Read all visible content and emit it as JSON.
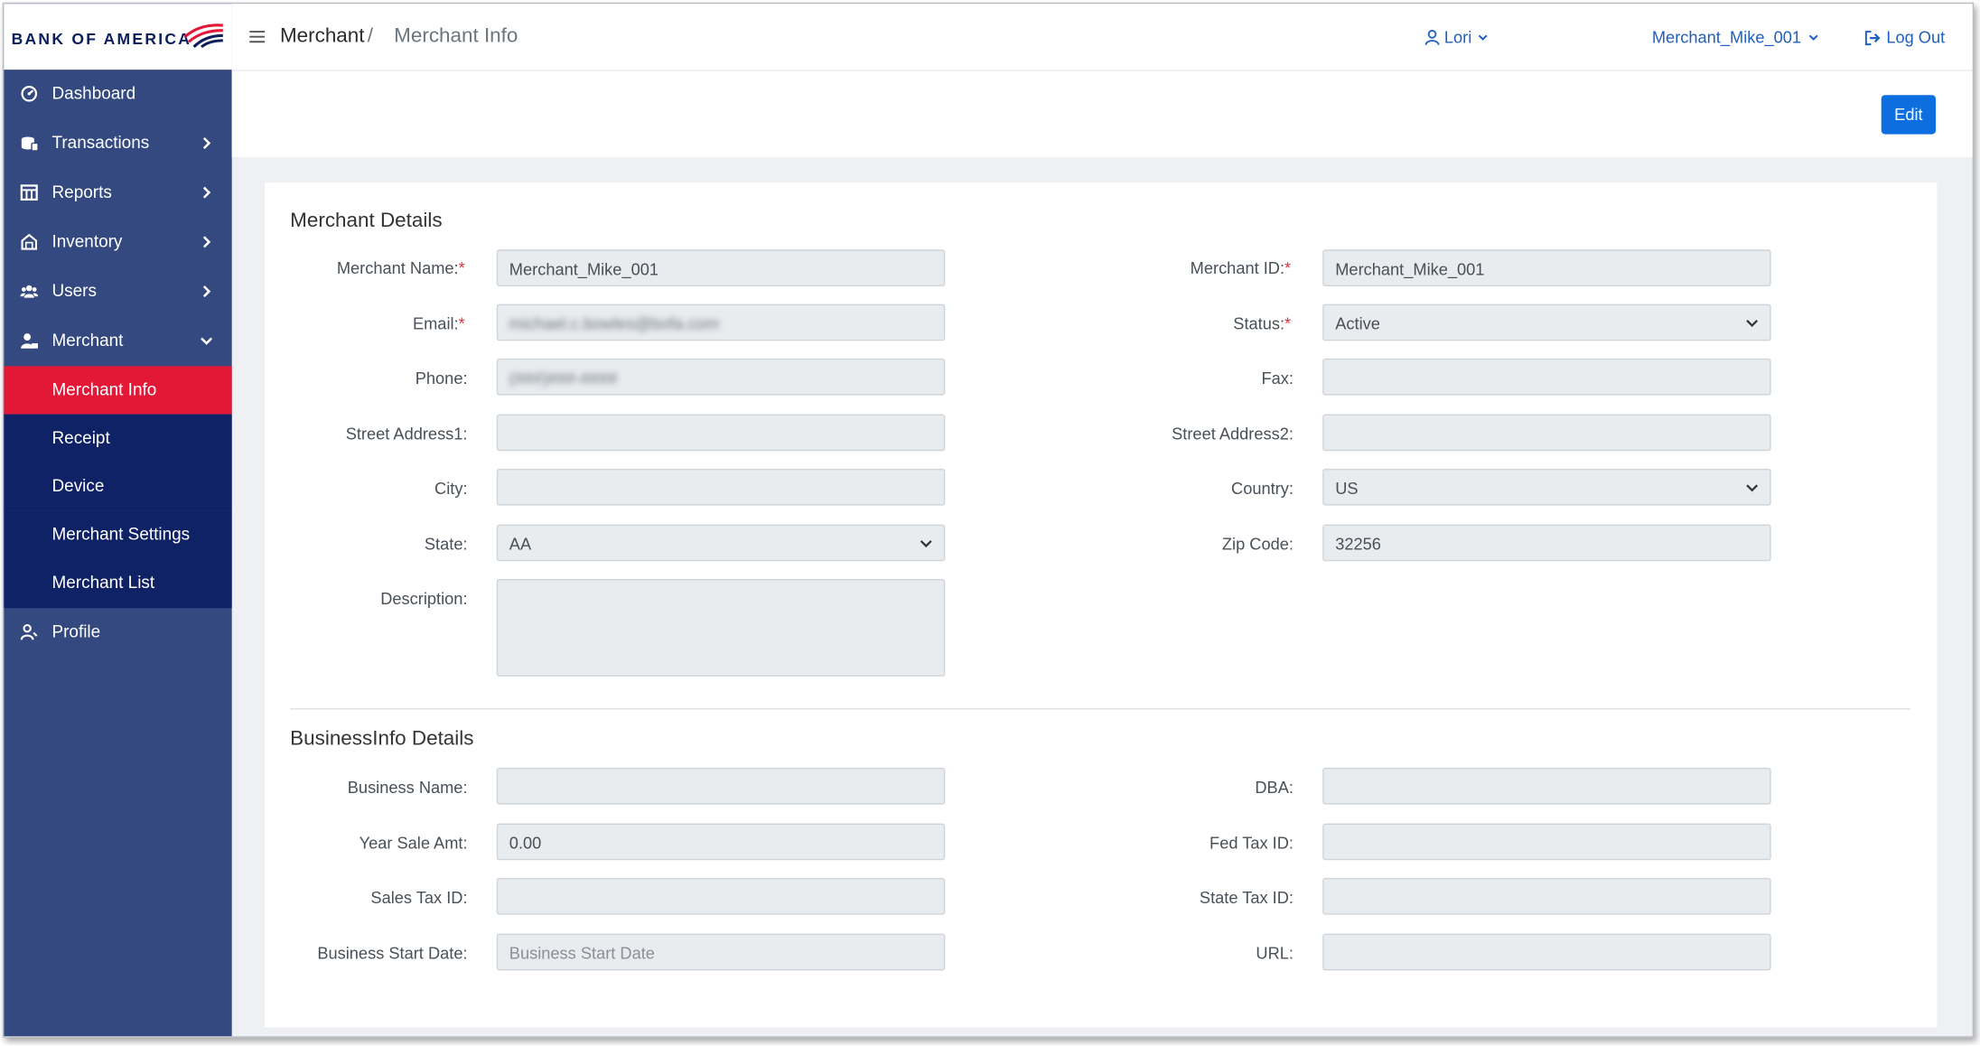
{
  "brand": {
    "name": "BANK OF AMERICA",
    "logo_icon": "bank-of-america-flag-logo"
  },
  "colors": {
    "sidebar_bg": "#34497f",
    "sidebar_sub_bg": "#0f2266",
    "active_item_bg": "#e31837",
    "primary_button": "#0d6ee0",
    "link": "#1f5fc1"
  },
  "sidebar": {
    "items": [
      {
        "label": "Dashboard",
        "icon": "dashboard-icon"
      },
      {
        "label": "Transactions",
        "icon": "transactions-icon"
      },
      {
        "label": "Reports",
        "icon": "reports-icon"
      },
      {
        "label": "Inventory",
        "icon": "inventory-icon"
      },
      {
        "label": "Users",
        "icon": "users-icon"
      },
      {
        "label": "Merchant",
        "icon": "merchant-icon"
      },
      {
        "label": "Profile",
        "icon": "profile-icon"
      }
    ],
    "merchant_sub": [
      {
        "label": "Merchant Info",
        "active": true
      },
      {
        "label": "Receipt"
      },
      {
        "label": "Device"
      },
      {
        "label": "Merchant Settings"
      },
      {
        "label": "Merchant List"
      }
    ]
  },
  "header": {
    "breadcrumb_root": "Merchant",
    "breadcrumb_sep": "/",
    "breadcrumb_current": "Merchant Info",
    "user": "Lori",
    "merchant_selector": "Merchant_Mike_001",
    "logout": "Log Out"
  },
  "actions": {
    "edit_label": "Edit"
  },
  "merchant_details": {
    "title": "Merchant Details",
    "fields": {
      "merchant_name": {
        "label": "Merchant Name:",
        "value": "Merchant_Mike_001"
      },
      "merchant_id": {
        "label": "Merchant ID:",
        "value": "Merchant_Mike_001"
      },
      "email": {
        "label": "Email:",
        "value": "michael.c.bowles@bofa.com"
      },
      "status": {
        "label": "Status:",
        "value": "Active"
      },
      "phone": {
        "label": "Phone:",
        "value": "(###)###-####"
      },
      "fax": {
        "label": "Fax:",
        "value": ""
      },
      "street1": {
        "label": "Street Address1:",
        "value": ""
      },
      "street2": {
        "label": "Street Address2:",
        "value": ""
      },
      "city": {
        "label": "City:",
        "value": ""
      },
      "country": {
        "label": "Country:",
        "value": "US"
      },
      "state": {
        "label": "State:",
        "value": "AA"
      },
      "zip": {
        "label": "Zip Code:",
        "value": "32256"
      },
      "description": {
        "label": "Description:",
        "value": ""
      }
    }
  },
  "business_details": {
    "title": "BusinessInfo Details",
    "fields": {
      "business_name": {
        "label": "Business Name:",
        "value": ""
      },
      "dba": {
        "label": "DBA:",
        "value": ""
      },
      "year_sale_amt": {
        "label": "Year Sale Amt:",
        "value": "0.00"
      },
      "fed_tax_id": {
        "label": "Fed Tax ID:",
        "value": ""
      },
      "sales_tax_id": {
        "label": "Sales Tax ID:",
        "value": ""
      },
      "state_tax_id": {
        "label": "State Tax ID:",
        "value": ""
      },
      "business_start_date": {
        "label": "Business Start Date:",
        "value": "",
        "placeholder": "Business Start Date"
      },
      "url": {
        "label": "URL:",
        "value": ""
      }
    }
  }
}
